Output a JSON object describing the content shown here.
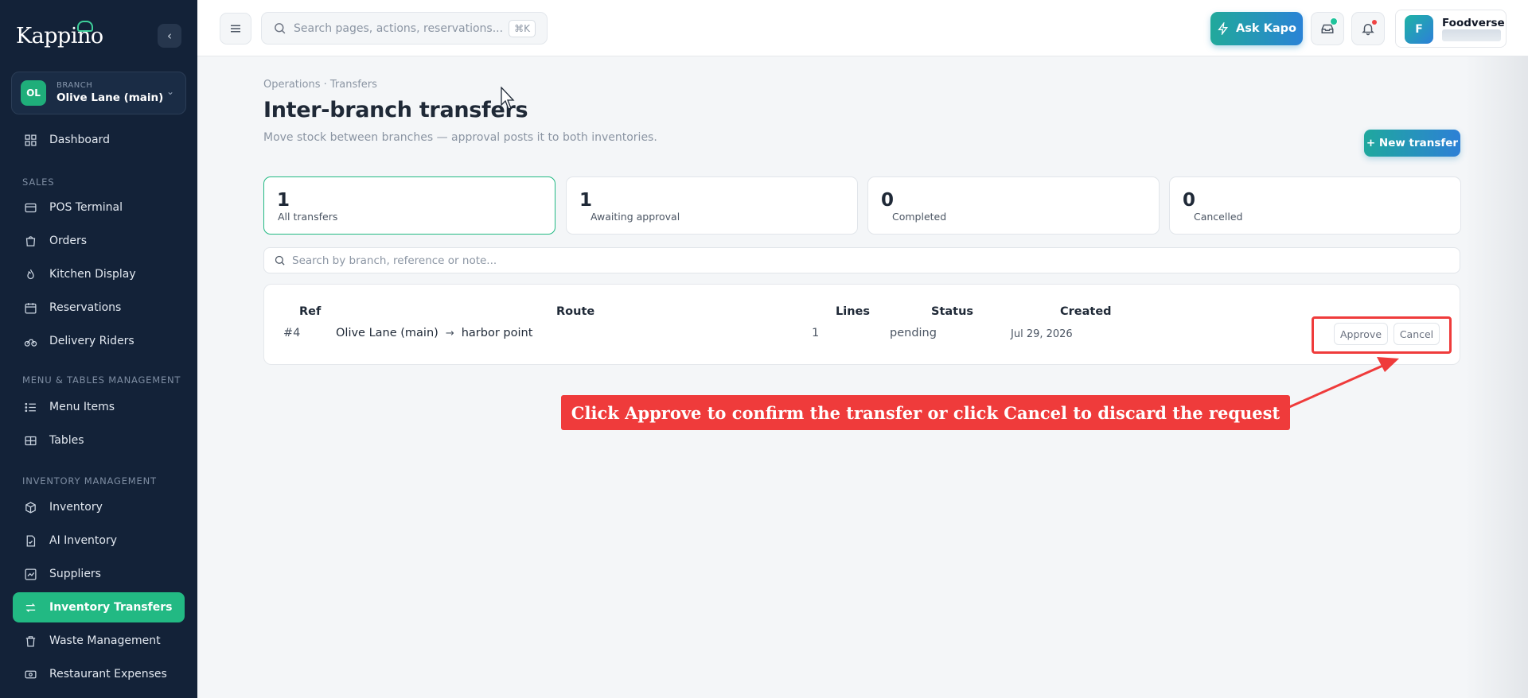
{
  "app": {
    "name": "Kappino"
  },
  "branch": {
    "initials": "OL",
    "label": "BRANCH",
    "name": "Olive Lane (main)"
  },
  "sidebar": {
    "dashboard": "Dashboard",
    "sections": [
      "SALES",
      "MENU & TABLES MANAGEMENT",
      "INVENTORY MANAGEMENT"
    ],
    "items": [
      {
        "label": "POS Terminal",
        "icon": "pos-icon"
      },
      {
        "label": "Orders",
        "icon": "bag-icon"
      },
      {
        "label": "Kitchen Display",
        "icon": "flame-icon"
      },
      {
        "label": "Reservations",
        "icon": "calendar-icon"
      },
      {
        "label": "Delivery Riders",
        "icon": "bike-icon"
      },
      {
        "label": "Menu Items",
        "icon": "list-icon"
      },
      {
        "label": "Tables",
        "icon": "grid-icon"
      },
      {
        "label": "Inventory",
        "icon": "box-icon"
      },
      {
        "label": "AI Inventory",
        "icon": "ai-doc-icon"
      },
      {
        "label": "Suppliers",
        "icon": "chart-icon"
      },
      {
        "label": "Inventory Transfers",
        "icon": "swap-icon",
        "active": true
      },
      {
        "label": "Waste Management",
        "icon": "trash-icon"
      },
      {
        "label": "Restaurant Expenses",
        "icon": "cash-icon"
      }
    ]
  },
  "topbar": {
    "search_placeholder": "Search pages, actions, reservations...",
    "shortcut": "⌘K",
    "ask_label": "Ask Kapo",
    "user_initial": "F",
    "user_name": "Foodverse"
  },
  "page": {
    "breadcrumb": "Operations · Transfers",
    "title": "Inter-branch transfers",
    "subtitle": "Move stock between branches — approval posts it to both inventories.",
    "new_button": "+ New transfer",
    "search_placeholder": "Search by branch, reference or note..."
  },
  "stats": [
    {
      "value": "1",
      "label": "All transfers",
      "active": true
    },
    {
      "value": "1",
      "label": "Awaiting approval"
    },
    {
      "value": "0",
      "label": "Completed"
    },
    {
      "value": "0",
      "label": "Cancelled"
    }
  ],
  "table": {
    "headers": {
      "ref": "Ref",
      "route": "Route",
      "lines": "Lines",
      "status": "Status",
      "created": "Created"
    },
    "rows": [
      {
        "ref": "#4",
        "from": "Olive Lane (main)",
        "to": "harbor point",
        "lines": "1",
        "status": "pending",
        "created": "Jul 29, 2026",
        "approve": "Approve",
        "cancel": "Cancel"
      }
    ]
  },
  "annotation": {
    "text": "Click Approve to confirm the transfer or click Cancel to discard the request",
    "color": "#ef3b3b"
  },
  "colors": {
    "sidebar": "#132238",
    "accent": "#22b983",
    "gradient_start": "#1fa89e",
    "gradient_end": "#2d80d6"
  }
}
